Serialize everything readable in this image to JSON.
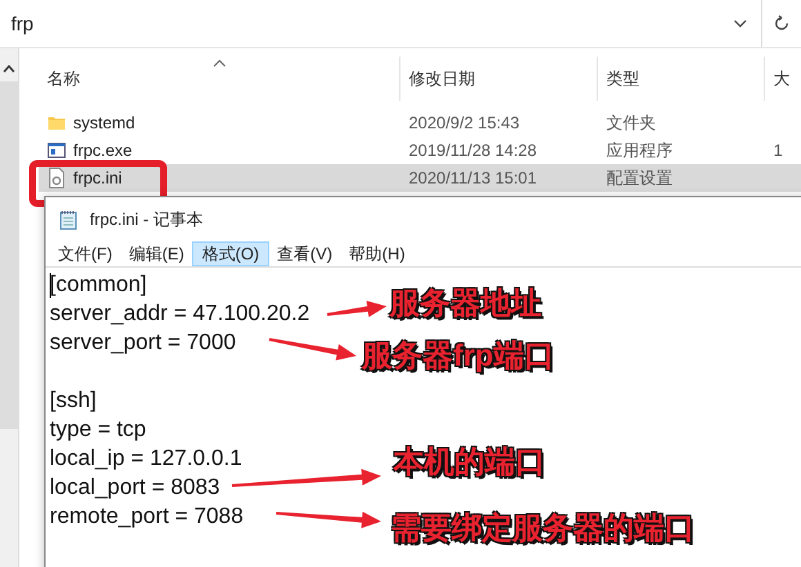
{
  "explorer": {
    "address": "frp",
    "columns": [
      {
        "label": "名称",
        "sorted": true
      },
      {
        "label": "修改日期",
        "sorted": false
      },
      {
        "label": "类型",
        "sorted": false
      },
      {
        "label": "大",
        "sorted": false
      }
    ],
    "rows": [
      {
        "kind": "folder",
        "name": "systemd",
        "date": "2020/9/2 15:43",
        "type": "文件夹",
        "selected": false,
        "circled": false
      },
      {
        "kind": "exe",
        "name": "frpc.exe",
        "date": "2019/11/28 14:28",
        "type": "应用程序",
        "size": "1",
        "selected": false,
        "circled": false
      },
      {
        "kind": "ini",
        "name": "frpc.ini",
        "date": "2020/11/13 15:01",
        "type": "配置设置",
        "selected": true,
        "circled": true
      }
    ]
  },
  "notepad": {
    "title": "frpc.ini - 记事本",
    "menu": [
      {
        "label": "文件(F)",
        "selected": false
      },
      {
        "label": "编辑(E)",
        "selected": false
      },
      {
        "label": "格式(O)",
        "selected": true
      },
      {
        "label": "查看(V)",
        "selected": false
      },
      {
        "label": "帮助(H)",
        "selected": false
      }
    ],
    "sections": [
      {
        "lines": [
          "[common]",
          "server_addr = 47.100.20.2",
          "server_port = 7000"
        ]
      },
      {
        "lines": [
          "[ssh]",
          "type = tcp",
          "local_ip = 127.0.0.1",
          "local_port = 8083",
          "remote_port = 7088"
        ]
      }
    ]
  },
  "annotations": [
    {
      "text": "服务器地址"
    },
    {
      "text": "服务器frp端口"
    },
    {
      "text": "本机的端口"
    },
    {
      "text": "需要绑定服务器的端口"
    }
  ]
}
